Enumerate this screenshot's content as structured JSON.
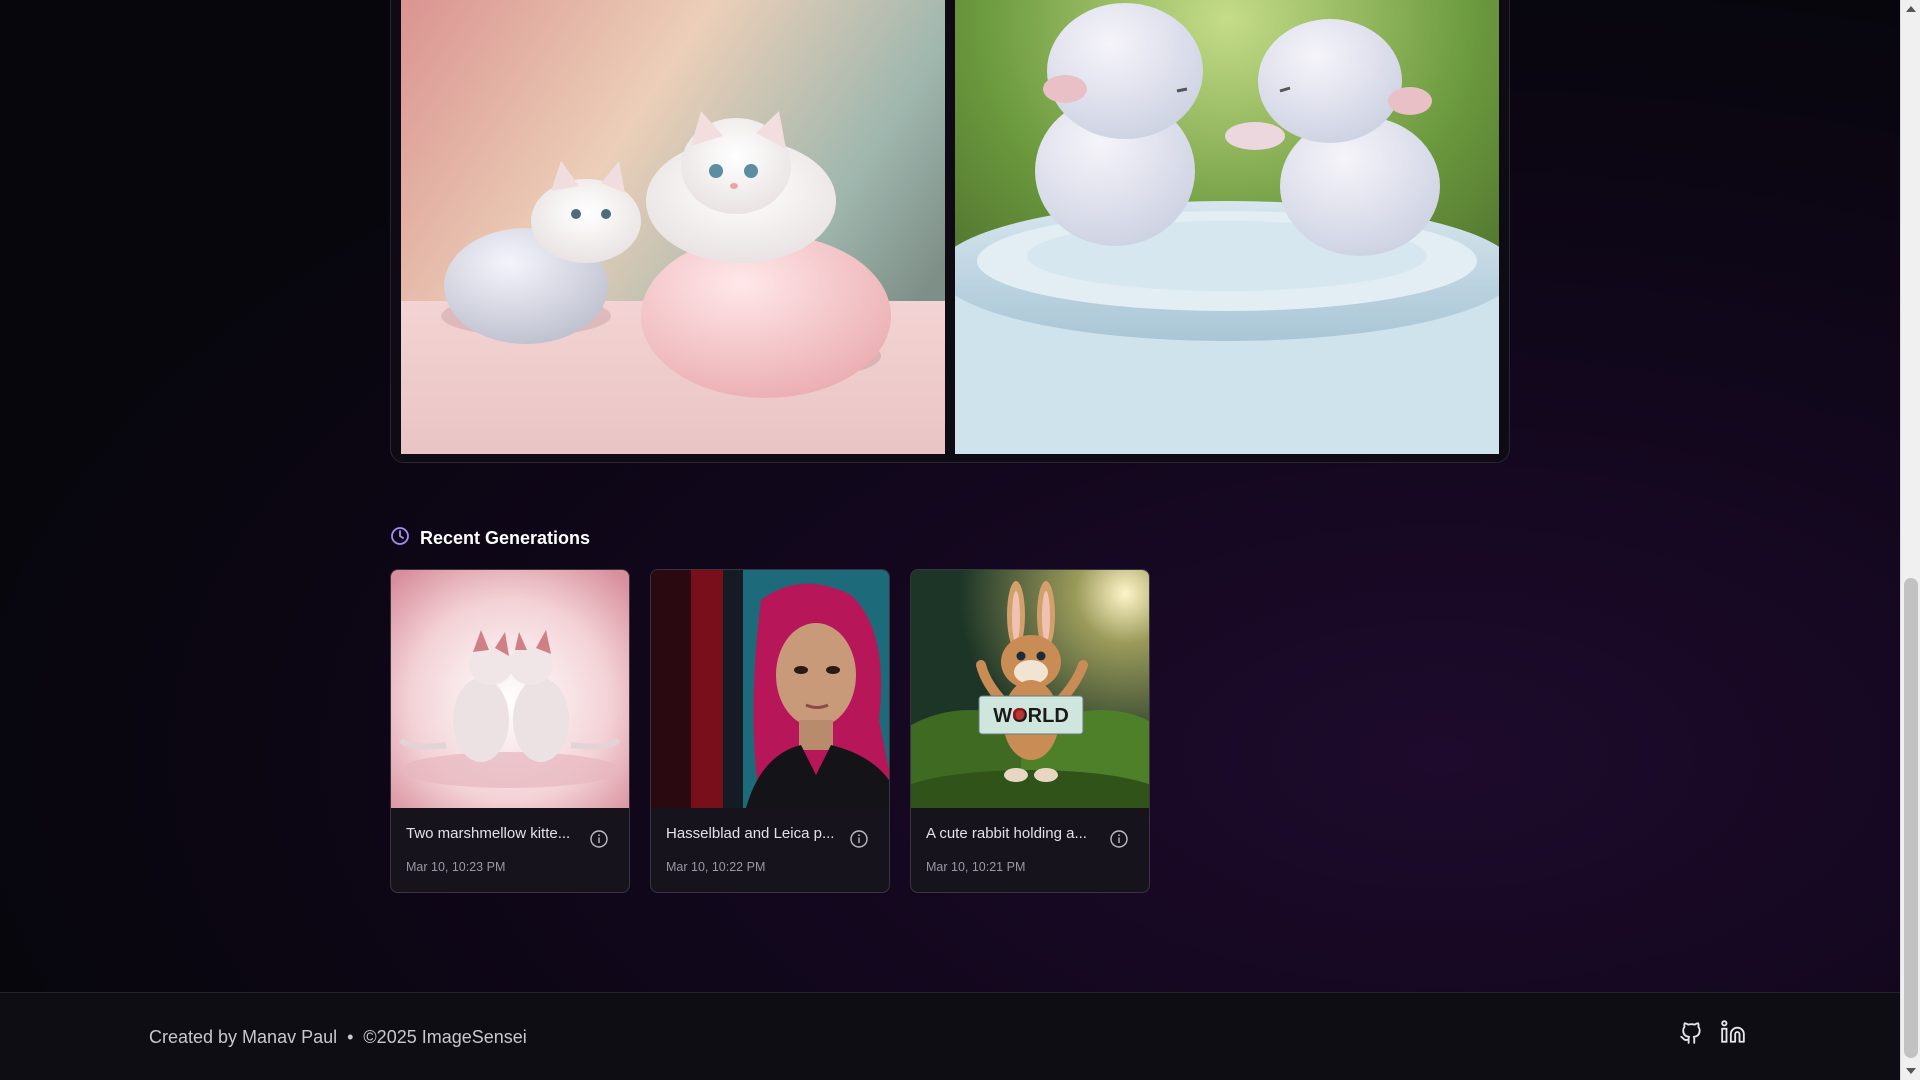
{
  "section": {
    "title": "Recent Generations",
    "icon": "clock-icon"
  },
  "recent": [
    {
      "caption": "Two marshmellow kitte...",
      "date": "Mar 10, 10:23 PM"
    },
    {
      "caption": "Hasselblad and Leica p...",
      "date": "Mar 10, 10:22 PM"
    },
    {
      "caption": "A cute rabbit holding a...",
      "date": "Mar 10, 10:21 PM"
    }
  ],
  "rabbit_sign_text": "WORLD",
  "footer": {
    "created_by": "Created by Manav Paul",
    "separator": "•",
    "copyright": "©2025 ImageSensei",
    "icons": [
      "github-icon",
      "linkedin-icon"
    ]
  },
  "colors": {
    "accent": "#a78bfa",
    "background": "#07060c",
    "card": "#16131c"
  }
}
